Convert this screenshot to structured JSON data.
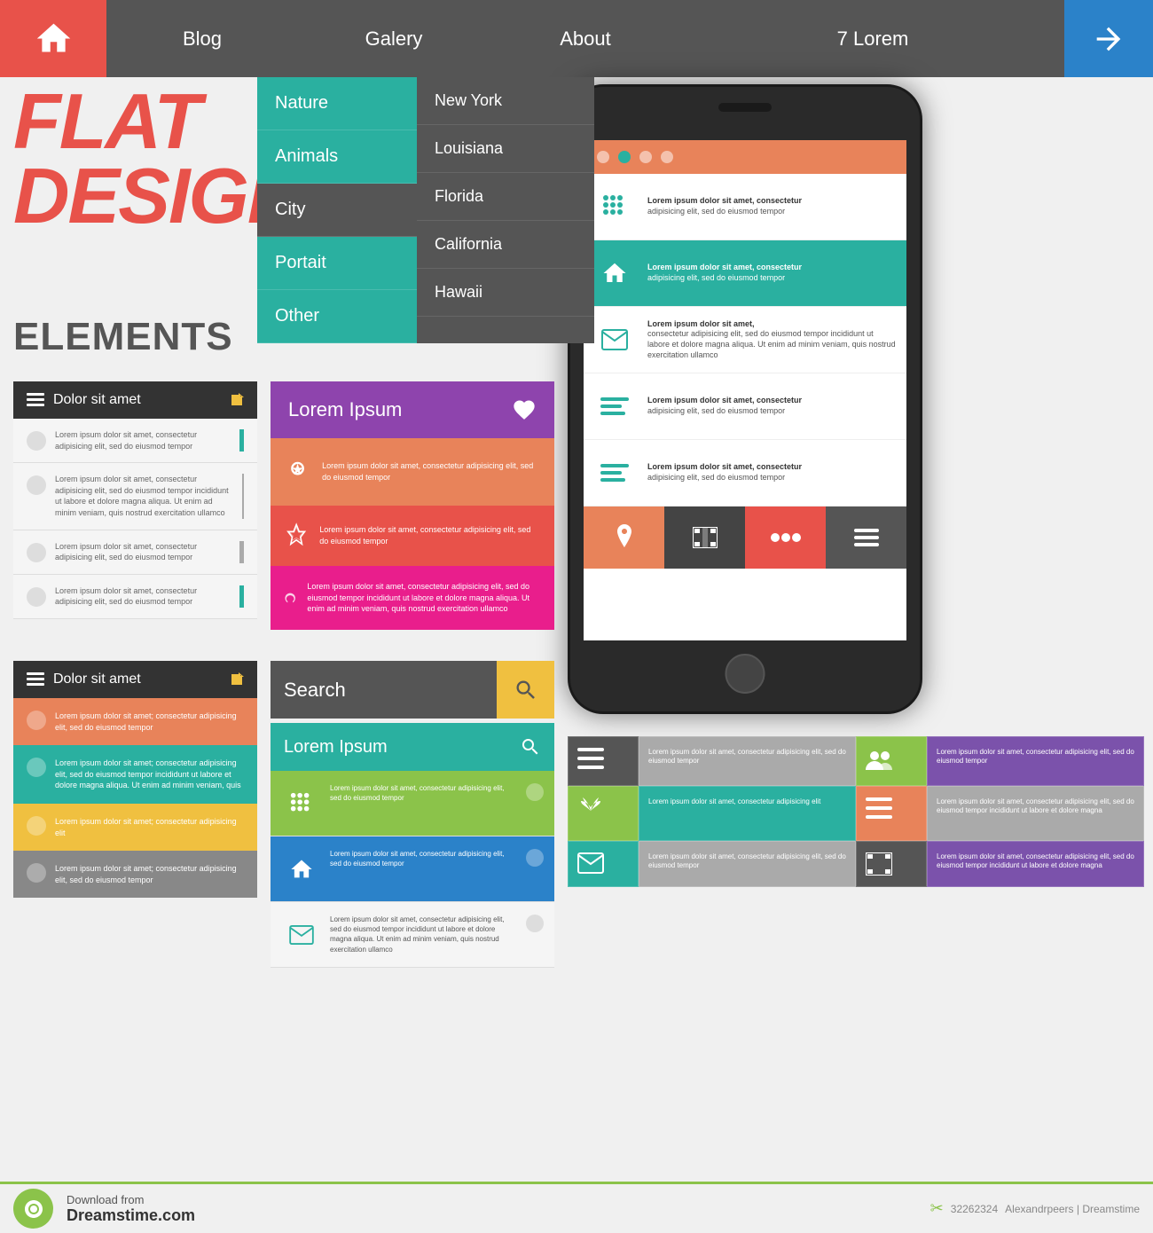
{
  "navbar": {
    "home_label": "Home",
    "blog_label": "Blog",
    "gallery_label": "Galery",
    "about_label": "About",
    "lorem_label": "7 Lorem"
  },
  "dropdown": {
    "col1": [
      {
        "label": "Nature",
        "active": false
      },
      {
        "label": "Animals",
        "active": false
      },
      {
        "label": "City",
        "active": true
      },
      {
        "label": "Portait",
        "active": false
      },
      {
        "label": "Other",
        "active": false
      }
    ],
    "col2": [
      {
        "label": "New York"
      },
      {
        "label": "Louisiana"
      },
      {
        "label": "Florida"
      },
      {
        "label": "California"
      },
      {
        "label": "Hawaii"
      }
    ]
  },
  "flat_title": {
    "line1": "FLAT",
    "line2": "DESIGN",
    "line3": "ELEMENTS"
  },
  "lorem_ipsum": "Lorem ipsum dolor sit amet, consectetur adipisicing elit, sed do eiusmod tempor",
  "lorem_long": "Lorem ipsum dolor sit amet, consectetur adipisicing elit, sed do eiusmod tempor incididunt ut labore et dolore magna aliqua. Ut enim ad minim veniam, quis nostrud exercitation ullamco",
  "dolor": "Dolor sit amet",
  "search_placeholder": "Search",
  "lorem_ipsum_title": "Lorem Ipsum",
  "panel1_title": "Dolor sit amet",
  "panel2_title": "Dolor sit amet",
  "dreamstime": {
    "download_text": "Download from",
    "site_name": "Dreamstime.com",
    "id": "32262324",
    "author": "Alexandrpeers | Dreamstime"
  }
}
